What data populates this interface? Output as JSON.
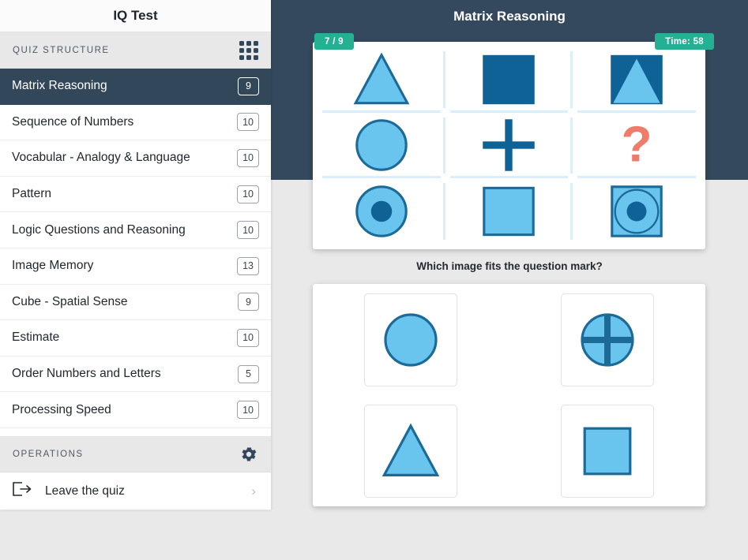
{
  "sidebar": {
    "title": "IQ Test",
    "quiz_structure_label": "QUIZ STRUCTURE",
    "grid_icon": "grid-apps-icon",
    "items": [
      {
        "label": "Matrix Reasoning",
        "count": "9",
        "active": true
      },
      {
        "label": "Sequence of Numbers",
        "count": "10",
        "active": false
      },
      {
        "label": "Vocabular - Analogy & Language",
        "count": "10",
        "active": false
      },
      {
        "label": "Pattern",
        "count": "10",
        "active": false
      },
      {
        "label": "Logic Questions and Reasoning",
        "count": "10",
        "active": false
      },
      {
        "label": "Image Memory",
        "count": "13",
        "active": false
      },
      {
        "label": "Cube - Spatial Sense",
        "count": "9",
        "active": false
      },
      {
        "label": "Estimate",
        "count": "10",
        "active": false
      },
      {
        "label": "Order Numbers and Letters",
        "count": "5",
        "active": false
      },
      {
        "label": "Processing Speed",
        "count": "10",
        "active": false
      }
    ],
    "operations_label": "OPERATIONS",
    "gear_icon": "gear-icon",
    "leave_quiz_label": "Leave the quiz",
    "leave_icon": "logout-arrow-icon",
    "chevron": "›"
  },
  "header": {
    "title": "Matrix Reasoning",
    "progress_badge": "7 / 9",
    "timer_badge": "Time: 58"
  },
  "puzzle": {
    "question": "Which image fits the question mark?",
    "cells": [
      {
        "shape": "triangle",
        "name": "matrix-cell-triangle"
      },
      {
        "shape": "square-dark",
        "name": "matrix-cell-dark-square"
      },
      {
        "shape": "square-triangle",
        "name": "matrix-cell-dark-square-triangle"
      },
      {
        "shape": "circle",
        "name": "matrix-cell-circle"
      },
      {
        "shape": "plus",
        "name": "matrix-cell-plus"
      },
      {
        "shape": "question",
        "name": "matrix-cell-question-mark"
      },
      {
        "shape": "circle-dot",
        "name": "matrix-cell-circle-dot"
      },
      {
        "shape": "square-light",
        "name": "matrix-cell-light-square"
      },
      {
        "shape": "square-circle-dot",
        "name": "matrix-cell-square-circle-dot"
      }
    ],
    "options": [
      {
        "shape": "circle",
        "name": "answer-option-circle"
      },
      {
        "shape": "circle-cross",
        "name": "answer-option-circle-cross"
      },
      {
        "shape": "triangle",
        "name": "answer-option-triangle"
      },
      {
        "shape": "square",
        "name": "answer-option-square"
      }
    ]
  },
  "colors": {
    "sidebar_active": "#33475b",
    "header_bg": "#34495e",
    "badge_green": "#24b193",
    "shape_light_blue": "#6ac5ee",
    "shape_dark_blue": "#0e6296",
    "shape_stroke": "#1b6a98",
    "question_mark": "#ef7b6b",
    "grid_line": "#dbeefb",
    "page_bg": "#e9e9e9"
  }
}
